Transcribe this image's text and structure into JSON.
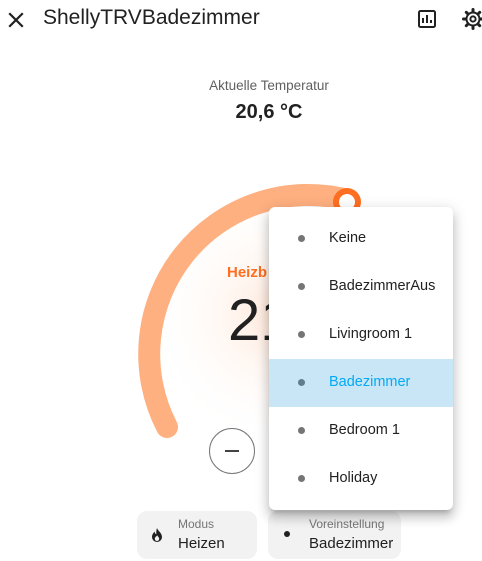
{
  "header": {
    "title": "ShellyTRVBadezimmer",
    "close_icon": "close-icon",
    "history_icon": "history-chart-icon",
    "settings_icon": "gear-icon"
  },
  "thermostat": {
    "current_label": "Aktuelle Temperatur",
    "current_value": "20,6 °C",
    "mode_label": "Heizb",
    "target_value_visible": "21",
    "accent_color": "#ff9f6a",
    "mode_color": "#ff6f22"
  },
  "chips": {
    "mode": {
      "title": "Modus",
      "value": "Heizen",
      "icon": "flame-icon"
    },
    "preset": {
      "title": "Voreinstellung",
      "value": "Badezimmer",
      "icon": "dot-icon"
    }
  },
  "preset_menu": {
    "items": [
      {
        "label": "Keine"
      },
      {
        "label": "BadezimmerAus"
      },
      {
        "label": "Livingroom 1"
      },
      {
        "label": "Badezimmer"
      },
      {
        "label": "Bedroom 1"
      },
      {
        "label": "Holiday"
      }
    ],
    "selected_label": "Badezimmer",
    "selected_bg": "#c8e6f6",
    "selected_text": "#03a9f4"
  }
}
